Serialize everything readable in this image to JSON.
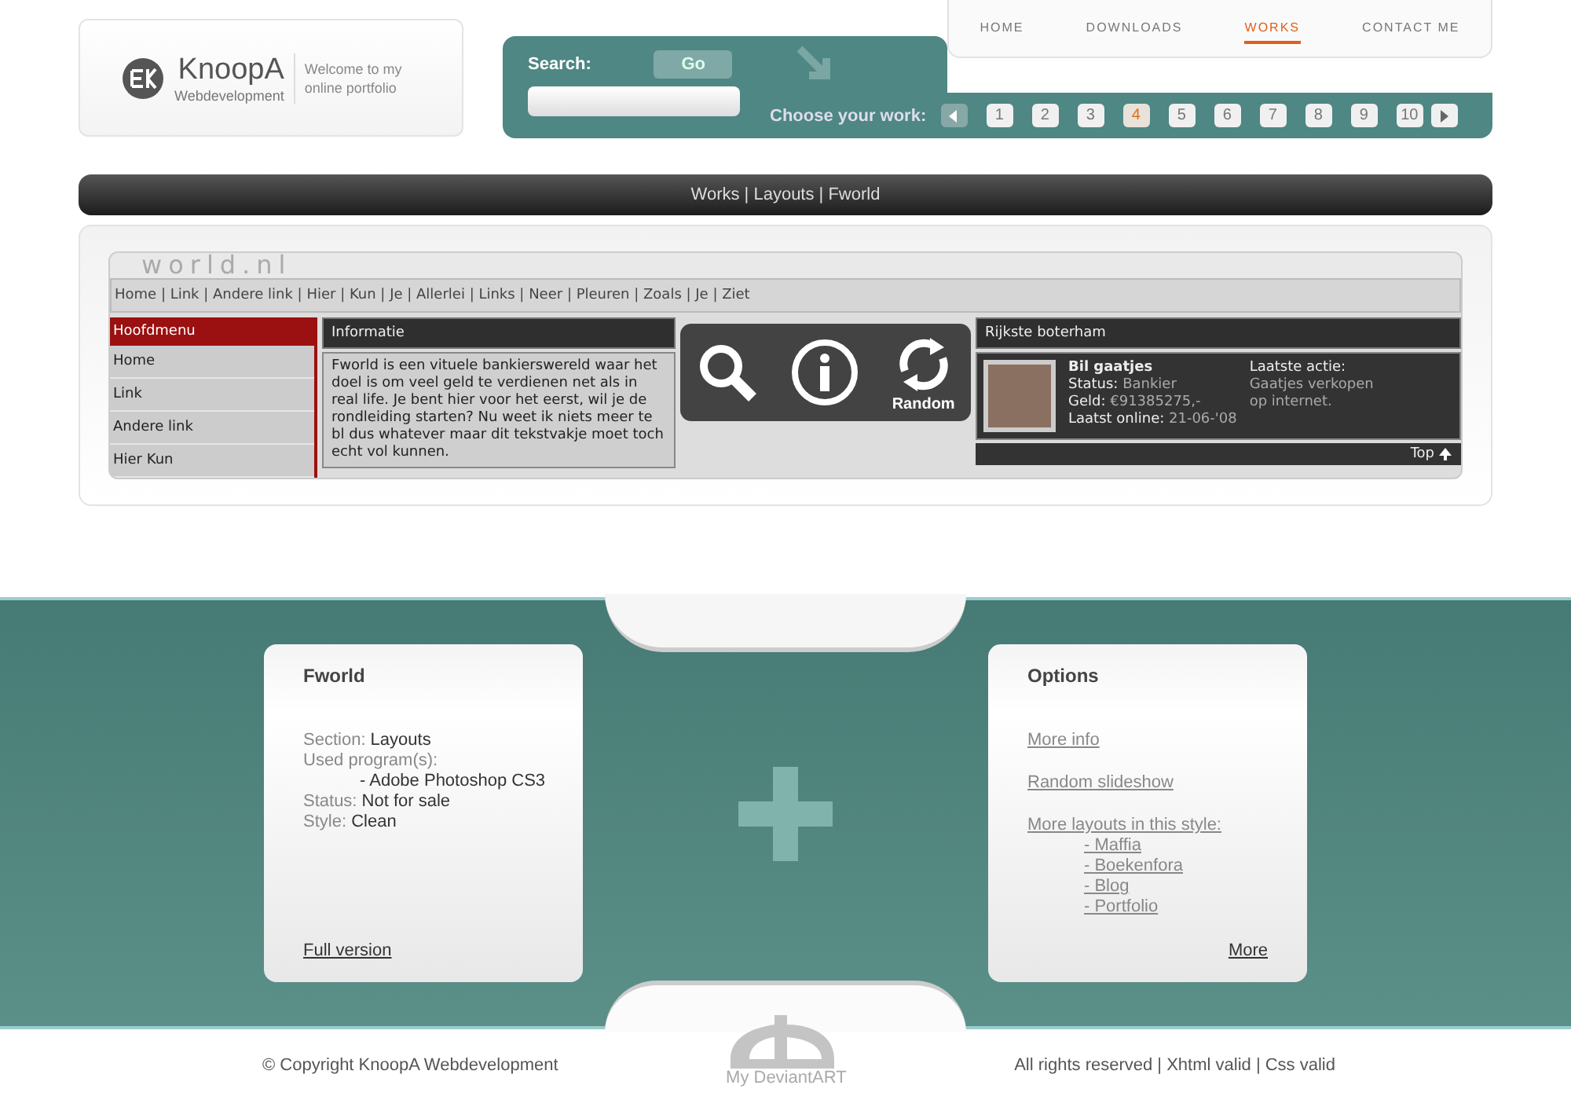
{
  "logo": {
    "name": "KnoopA",
    "subtitle": "Webdevelopment",
    "tagline": "Welcome to my online portfolio"
  },
  "nav": [
    {
      "label": "HOME",
      "selected": false
    },
    {
      "label": "DOWNLOADS",
      "selected": false
    },
    {
      "label": "WORKS",
      "selected": true
    },
    {
      "label": "CONTACT ME",
      "selected": false
    }
  ],
  "search": {
    "label": "Search:",
    "button": "Go"
  },
  "chooser": {
    "label": "Choose your work:",
    "pages": [
      {
        "label": "1",
        "selected": false
      },
      {
        "label": "2",
        "selected": false
      },
      {
        "label": "3",
        "selected": false
      },
      {
        "label": "4",
        "selected": true
      },
      {
        "label": "5",
        "selected": false
      },
      {
        "label": "6",
        "selected": false
      },
      {
        "label": "7",
        "selected": false
      },
      {
        "label": "8",
        "selected": false
      },
      {
        "label": "9",
        "selected": false
      },
      {
        "label": "10",
        "selected": false
      }
    ]
  },
  "breadcrumb": "Works | Layouts | Fworld",
  "preview": {
    "logo": "world.nl",
    "nav": "Home | Link | Andere link | Hier | Kun | Je | Allerlei | Links | Neer | Pleuren | Zoals | Je | Ziet",
    "menu_title": "Hoofdmenu",
    "menu": [
      "Home",
      "Link",
      "Andere link",
      "Hier Kun"
    ],
    "info_title": "Informatie",
    "info_text": "Fworld is een vituele bankierswereld waar het doel is om veel geld te verdienen net als in real life. Je bent hier voor het eerst, wil je de rondleiding starten? Nu weet ik niets meer te bl dus whatever maar dit tekstvakje moet toch echt vol kunnen.",
    "rich_title": "Rijkste boterham",
    "player": "Bil gaatjes",
    "stats": [
      {
        "label": "Status:",
        "value": "Bankier"
      },
      {
        "label": "Geld:",
        "value": "€91385275,-"
      },
      {
        "label": "Laatst online:",
        "value": "21-06-'08"
      }
    ],
    "action_label": "Laatste actie:",
    "action": "Gaatjes verkopen op internet.",
    "top": "Top"
  },
  "overlay": {
    "random": "Random"
  },
  "info_card": {
    "title": "Fworld",
    "rows": [
      {
        "label": "Section:",
        "value": "Layouts"
      }
    ],
    "programs_label": "Used program(s):",
    "program": "- Adobe Photoshop CS3",
    "rows2": [
      {
        "label": "Status:",
        "value": "Not for sale"
      },
      {
        "label": "Style:",
        "value": "Clean"
      }
    ],
    "link": "Full version"
  },
  "options_card": {
    "title": "Options",
    "links": [
      "More info",
      "Random slideshow",
      "More layouts in this style:"
    ],
    "sublinks": [
      "- Maffia",
      "- Boekenfora",
      "- Blog",
      "- Portfolio"
    ],
    "more": "More"
  },
  "footer": {
    "copyright": "© Copyright KnoopA Webdevelopment",
    "deviant": "My DeviantART",
    "right": "All rights reserved | Xhtml valid | Css valid"
  }
}
